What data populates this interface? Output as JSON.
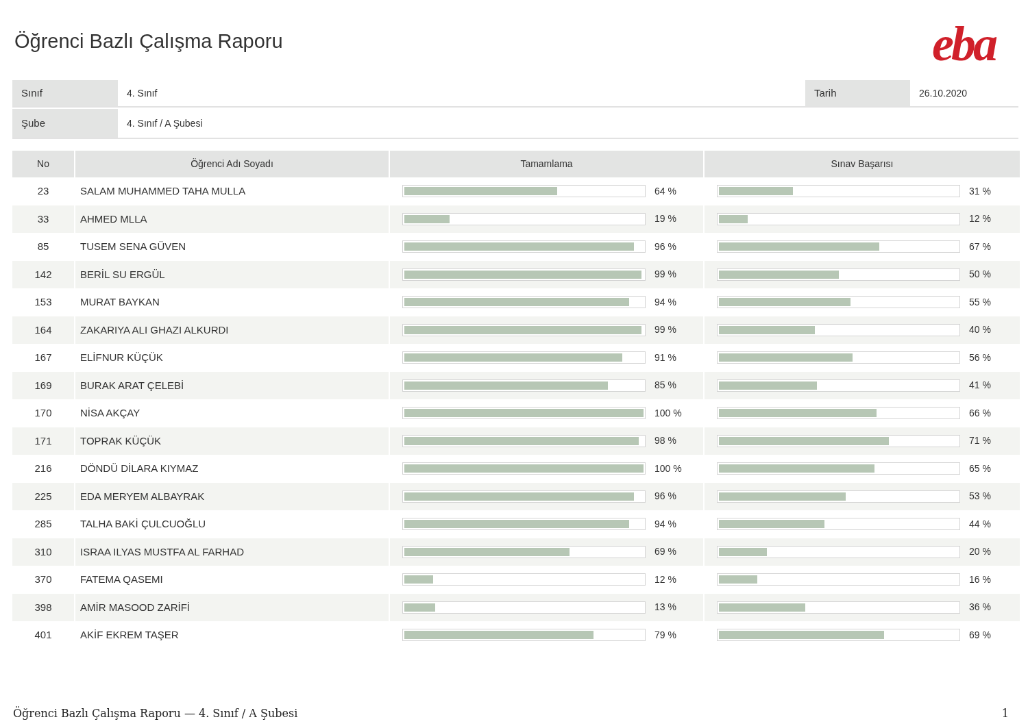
{
  "title": "Öğrenci Bazlı Çalışma Raporu",
  "logo": "eba",
  "info": {
    "class_label": "Sınıf",
    "class_value": "4. Sınıf",
    "date_label": "Tarih",
    "date_value": "26.10.2020",
    "branch_label": "Şube",
    "branch_value": "4. Sınıf / A Şubesi"
  },
  "table": {
    "columns": [
      "No",
      "Öğrenci Adı Soyadı",
      "Tamamlama",
      "Sınav Başarısı"
    ],
    "rows": [
      {
        "no": "23",
        "name": "SALAM MUHAMMED TAHA MULLA",
        "completion": {
          "level": 0.64,
          "reading": "64 %"
        },
        "exam": {
          "level": 0.31,
          "reading": "31 %"
        }
      },
      {
        "no": "33",
        "name": "AHMED MLLA",
        "completion": {
          "level": 0.19,
          "reading": "19 %"
        },
        "exam": {
          "level": 0.12,
          "reading": "12 %"
        }
      },
      {
        "no": "85",
        "name": "TUSEM SENA GÜVEN",
        "completion": {
          "level": 0.96,
          "reading": "96 %"
        },
        "exam": {
          "level": 0.67,
          "reading": "67 %"
        }
      },
      {
        "no": "142",
        "name": "BERİL SU ERGÜL",
        "completion": {
          "level": 0.99,
          "reading": "99 %"
        },
        "exam": {
          "level": 0.5,
          "reading": "50 %"
        }
      },
      {
        "no": "153",
        "name": "MURAT BAYKAN",
        "completion": {
          "level": 0.94,
          "reading": "94 %"
        },
        "exam": {
          "level": 0.55,
          "reading": "55 %"
        }
      },
      {
        "no": "164",
        "name": "ZAKARIYA ALI GHAZI ALKURDI",
        "completion": {
          "level": 0.99,
          "reading": "99 %"
        },
        "exam": {
          "level": 0.4,
          "reading": "40 %"
        }
      },
      {
        "no": "167",
        "name": "ELİFNUR KÜÇÜK",
        "completion": {
          "level": 0.91,
          "reading": "91 %"
        },
        "exam": {
          "level": 0.56,
          "reading": "56 %"
        }
      },
      {
        "no": "169",
        "name": "BURAK ARAT ÇELEBİ",
        "completion": {
          "level": 0.85,
          "reading": "85 %"
        },
        "exam": {
          "level": 0.41,
          "reading": "41 %"
        }
      },
      {
        "no": "170",
        "name": "NİSA AKÇAY",
        "completion": {
          "level": 1,
          "reading": "100 %"
        },
        "exam": {
          "level": 0.66,
          "reading": "66 %"
        }
      },
      {
        "no": "171",
        "name": "TOPRAK KÜÇÜK",
        "completion": {
          "level": 0.98,
          "reading": "98 %"
        },
        "exam": {
          "level": 0.71,
          "reading": "71 %"
        }
      },
      {
        "no": "216",
        "name": "DÖNDÜ DİLARA KIYMAZ",
        "completion": {
          "level": 1,
          "reading": "100 %"
        },
        "exam": {
          "level": 0.65,
          "reading": "65 %"
        }
      },
      {
        "no": "225",
        "name": "EDA MERYEM ALBAYRAK",
        "completion": {
          "level": 0.96,
          "reading": "96 %"
        },
        "exam": {
          "level": 0.53,
          "reading": "53 %"
        }
      },
      {
        "no": "285",
        "name": "TALHA BAKİ ÇULCUOĞLU",
        "completion": {
          "level": 0.94,
          "reading": "94 %"
        },
        "exam": {
          "level": 0.44,
          "reading": "44 %"
        }
      },
      {
        "no": "310",
        "name": "ISRAA ILYAS MUSTFA AL FARHAD",
        "completion": {
          "level": 0.69,
          "reading": "69 %"
        },
        "exam": {
          "level": 0.2,
          "reading": "20 %"
        }
      },
      {
        "no": "370",
        "name": "FATEMA QASEMI",
        "completion": {
          "level": 0.12,
          "reading": "12 %"
        },
        "exam": {
          "level": 0.16,
          "reading": "16 %"
        }
      },
      {
        "no": "398",
        "name": "AMİR MASOOD ZARİFİ",
        "completion": {
          "level": 0.13,
          "reading": "13 %"
        },
        "exam": {
          "level": 0.36,
          "reading": "36 %"
        }
      },
      {
        "no": "401",
        "name": "AKİF EKREM TAŞER",
        "completion": {
          "level": 0.79,
          "reading": "79 %"
        },
        "exam": {
          "level": 0.69,
          "reading": "69 %"
        }
      }
    ]
  },
  "footer": {
    "text": "Öğrenci Bazlı Çalışma Raporu — 4. Sınıf / A Şubesi",
    "page": "1"
  }
}
